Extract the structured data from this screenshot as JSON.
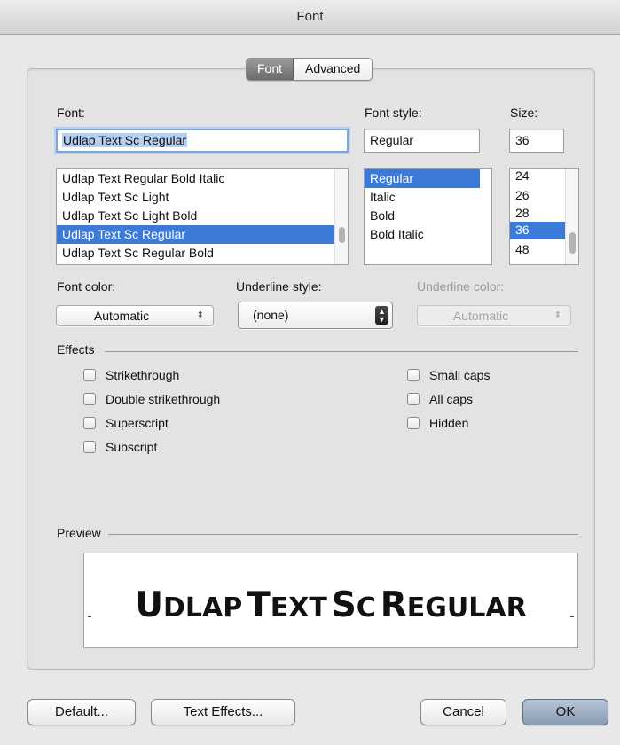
{
  "window": {
    "title": "Font"
  },
  "tabs": [
    {
      "label": "Font",
      "active": true
    },
    {
      "label": "Advanced",
      "active": false
    }
  ],
  "font": {
    "label": "Font:",
    "value": "Udlap Text Sc Regular",
    "list": [
      "Udlap Text Regular Bold Italic",
      "Udlap Text Sc Light",
      "Udlap Text Sc Light Bold",
      "Udlap Text Sc Regular",
      "Udlap Text Sc Regular Bold"
    ],
    "selected_index": 3
  },
  "font_style": {
    "label": "Font style:",
    "value": "Regular",
    "list": [
      "Regular",
      "Italic",
      "Bold",
      "Bold Italic"
    ],
    "selected_index": 0
  },
  "size": {
    "label": "Size:",
    "value": "36",
    "list": [
      "24",
      "26",
      "28",
      "36",
      "48"
    ],
    "selected_index": 3
  },
  "font_color": {
    "label": "Font color:",
    "value": "Automatic"
  },
  "underline_style": {
    "label": "Underline style:",
    "value": "(none)"
  },
  "underline_color": {
    "label": "Underline color:",
    "value": "Automatic",
    "enabled": false
  },
  "effects": {
    "title": "Effects",
    "left": [
      {
        "label": "Strikethrough",
        "checked": false
      },
      {
        "label": "Double strikethrough",
        "checked": false
      },
      {
        "label": "Superscript",
        "checked": false
      },
      {
        "label": "Subscript",
        "checked": false
      }
    ],
    "right": [
      {
        "label": "Small caps",
        "checked": false
      },
      {
        "label": "All caps",
        "checked": false
      },
      {
        "label": "Hidden",
        "checked": false
      }
    ]
  },
  "preview": {
    "title": "Preview",
    "sample": "Udlap Text Sc Regular"
  },
  "buttons": {
    "default": "Default...",
    "text_effects": "Text Effects...",
    "cancel": "Cancel",
    "ok": "OK"
  },
  "colors": {
    "selection": "#3c7ad9",
    "text_highlight": "#b5d0f3",
    "focus_ring": "#7fa6d8"
  }
}
